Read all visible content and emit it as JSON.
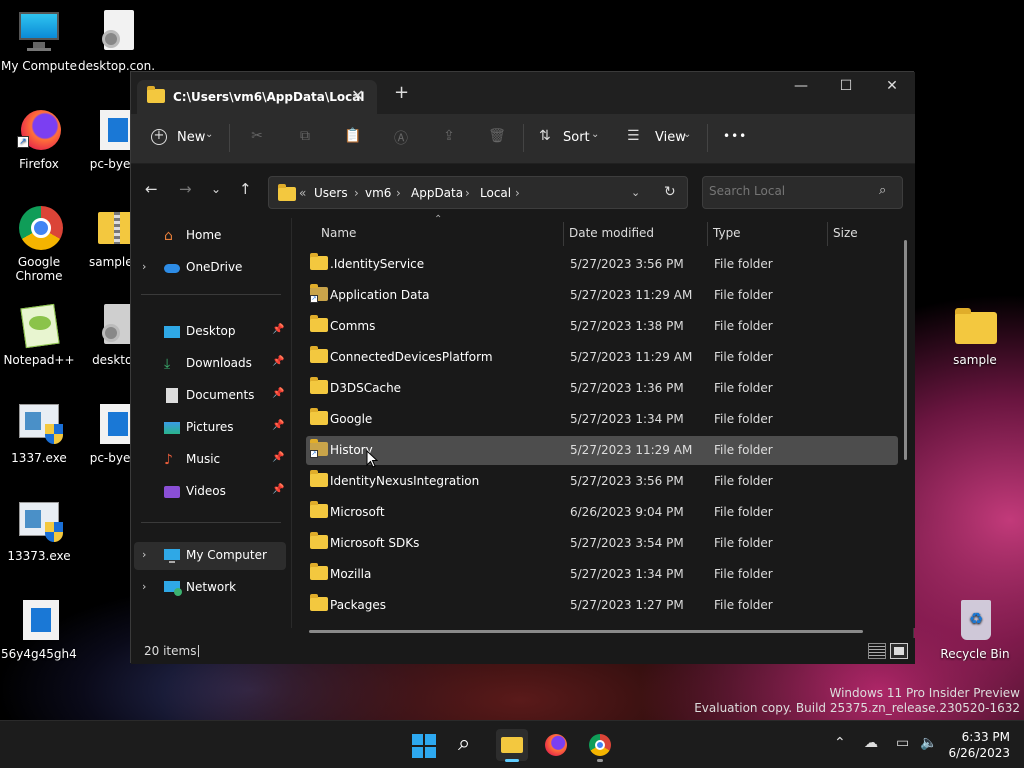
{
  "desktop": {
    "icons": [
      {
        "label": "My Computer"
      },
      {
        "label": "desktop.con..."
      },
      {
        "label": "Firefox"
      },
      {
        "label": "pc-bye-b"
      },
      {
        "label": "Google Chrome"
      },
      {
        "label": "sample.c"
      },
      {
        "label": "Notepad++"
      },
      {
        "label": "desktop"
      },
      {
        "label": "1337.exe"
      },
      {
        "label": "pc-bye-b"
      },
      {
        "label": "13373.exe"
      },
      {
        "label": "56y4g45gh4..."
      },
      {
        "label": "sample"
      },
      {
        "label": "Recycle Bin"
      }
    ],
    "watermark_line1": "Windows 11 Pro Insider Preview",
    "watermark_line2": "Evaluation copy. Build 25375.zn_release.230520-1632"
  },
  "window": {
    "tab_title": "C:\\Users\\vm6\\AppData\\Local",
    "tab_close": "✕",
    "new_tab": "+",
    "controls": {
      "minimize": "—",
      "maximize": "☐",
      "close": "✕"
    }
  },
  "toolbar": {
    "new_label": "New",
    "sort_label": "Sort",
    "view_label": "View",
    "more_label": "•••"
  },
  "address": {
    "breadcrumbs": [
      "Users",
      "vm6",
      "AppData",
      "Local"
    ],
    "search_placeholder": "Search Local"
  },
  "navpane": {
    "items": [
      {
        "label": "Home"
      },
      {
        "label": "OneDrive"
      },
      {
        "label": "Desktop"
      },
      {
        "label": "Downloads"
      },
      {
        "label": "Documents"
      },
      {
        "label": "Pictures"
      },
      {
        "label": "Music"
      },
      {
        "label": "Videos"
      },
      {
        "label": "My Computer"
      },
      {
        "label": "Network"
      }
    ]
  },
  "filelist": {
    "columns": {
      "name": "Name",
      "date": "Date modified",
      "type": "Type",
      "size": "Size"
    },
    "rows": [
      {
        "name": ".IdentityService",
        "date": "5/27/2023 3:56 PM",
        "type": "File folder"
      },
      {
        "name": "Application Data",
        "date": "5/27/2023 11:29 AM",
        "type": "File folder"
      },
      {
        "name": "Comms",
        "date": "5/27/2023 1:38 PM",
        "type": "File folder"
      },
      {
        "name": "ConnectedDevicesPlatform",
        "date": "5/27/2023 11:29 AM",
        "type": "File folder"
      },
      {
        "name": "D3DSCache",
        "date": "5/27/2023 1:36 PM",
        "type": "File folder"
      },
      {
        "name": "Google",
        "date": "5/27/2023 1:34 PM",
        "type": "File folder"
      },
      {
        "name": "History",
        "date": "5/27/2023 11:29 AM",
        "type": "File folder"
      },
      {
        "name": "IdentityNexusIntegration",
        "date": "5/27/2023 3:56 PM",
        "type": "File folder"
      },
      {
        "name": "Microsoft",
        "date": "6/26/2023 9:04 PM",
        "type": "File folder"
      },
      {
        "name": "Microsoft SDKs",
        "date": "5/27/2023 3:54 PM",
        "type": "File folder"
      },
      {
        "name": "Mozilla",
        "date": "5/27/2023 1:34 PM",
        "type": "File folder"
      },
      {
        "name": "Packages",
        "date": "5/27/2023 1:27 PM",
        "type": "File folder"
      }
    ]
  },
  "status": {
    "item_count": "20 items"
  },
  "taskbar": {
    "time": "6:33 PM",
    "date": "6/26/2023"
  },
  "colors": {
    "folder": "#f3c83f",
    "accent": "#0078d4",
    "window_bg": "#191919"
  }
}
